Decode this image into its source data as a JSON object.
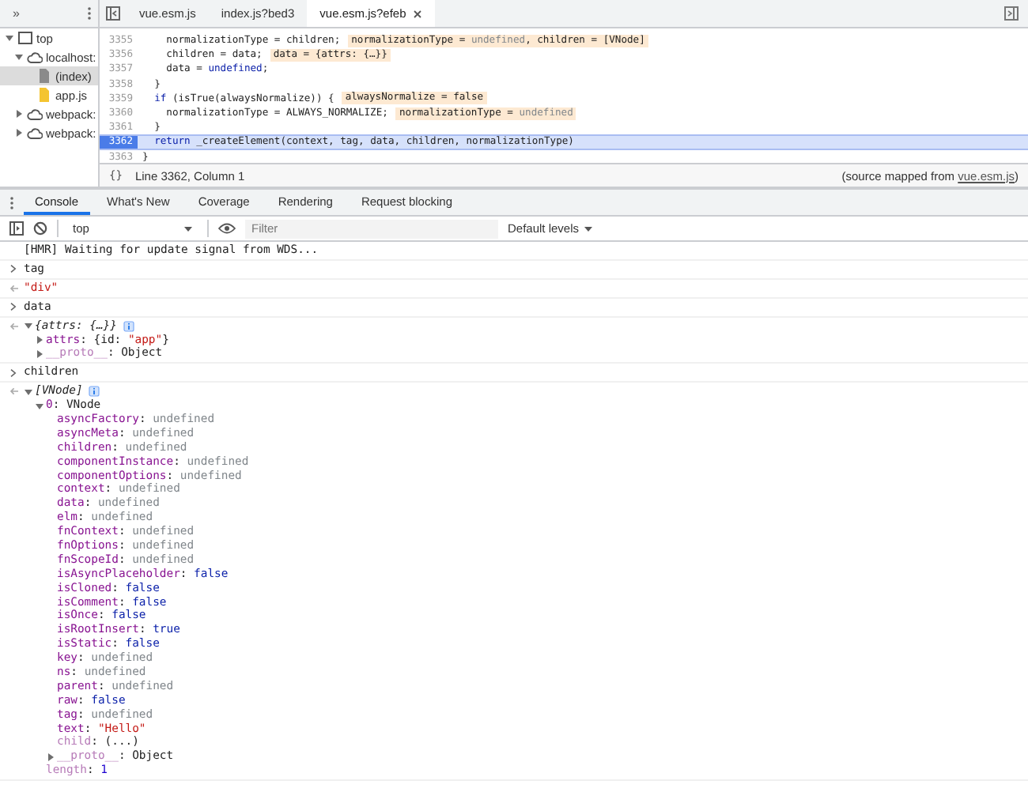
{
  "sources": {
    "navigator": {
      "overflow": "»",
      "items": [
        {
          "label": "top",
          "kind": "frame",
          "expanded": true,
          "selected": false,
          "children": [
            {
              "label": "localhost:",
              "kind": "domain",
              "expanded": true,
              "selected": false,
              "children": [
                {
                  "label": "(index)",
                  "kind": "document",
                  "selected": true
                },
                {
                  "label": "app.js",
                  "kind": "script",
                  "selected": false
                }
              ]
            },
            {
              "label": "webpack:",
              "kind": "domain",
              "expanded": false,
              "selected": false
            },
            {
              "label": "webpack:",
              "kind": "domain",
              "expanded": false,
              "selected": false
            }
          ]
        }
      ]
    },
    "tabs": [
      {
        "label": "vue.esm.js",
        "selected": false
      },
      {
        "label": "index.js?bed3",
        "selected": false
      },
      {
        "label": "vue.esm.js?efeb",
        "selected": true
      }
    ],
    "code": [
      {
        "number": "3355",
        "current": false,
        "tokens": [
          {
            "text": "    normalizationType = children;",
            "kind": "plain"
          }
        ],
        "inline": [
          {
            "text": "normalizationType = ",
            "kind": "plain"
          },
          {
            "text": "undefined",
            "kind": "dim"
          },
          {
            "text": ", children = [VNode]",
            "kind": "plain"
          }
        ]
      },
      {
        "number": "3356",
        "current": false,
        "tokens": [
          {
            "text": "    children = data;",
            "kind": "plain"
          }
        ],
        "inline": [
          {
            "text": "data = {attrs: {…}}",
            "kind": "plain"
          }
        ]
      },
      {
        "number": "3357",
        "current": false,
        "tokens": [
          {
            "text": "    data = ",
            "kind": "plain"
          },
          {
            "text": "undefined",
            "kind": "kw"
          },
          {
            "text": ";",
            "kind": "plain"
          }
        ]
      },
      {
        "number": "3358",
        "current": false,
        "tokens": [
          {
            "text": "  }",
            "kind": "plain"
          }
        ]
      },
      {
        "number": "3359",
        "current": false,
        "tokens": [
          {
            "text": "  if",
            "kind": "kw"
          },
          {
            "text": " (isTrue(alwaysNormalize)) {",
            "kind": "plain"
          }
        ],
        "inline": [
          {
            "text": "alwaysNormalize = false",
            "kind": "plain"
          }
        ]
      },
      {
        "number": "3360",
        "current": false,
        "tokens": [
          {
            "text": "    normalizationType = ALWAYS_NORMALIZE;",
            "kind": "plain"
          }
        ],
        "inline": [
          {
            "text": "normalizationType = ",
            "kind": "plain"
          },
          {
            "text": "undefined",
            "kind": "dim"
          }
        ]
      },
      {
        "number": "3361",
        "current": false,
        "tokens": [
          {
            "text": "  }",
            "kind": "plain"
          }
        ]
      },
      {
        "number": "3362",
        "current": true,
        "tokens": [
          {
            "text": "  return",
            "kind": "kw"
          },
          {
            "text": " _createElement(context, tag, data, children, normalizationType)",
            "kind": "plain"
          }
        ]
      },
      {
        "number": "3363",
        "current": false,
        "tokens": [
          {
            "text": "}",
            "kind": "plain"
          }
        ]
      }
    ],
    "status": {
      "pretty_print": "{}",
      "position": "Line 3362, Column 1",
      "source_note": {
        "before": "(source mapped from ",
        "link": "vue.esm.js",
        "after": ")"
      }
    }
  },
  "console": {
    "tabs": [
      {
        "label": "Console",
        "selected": true
      },
      {
        "label": "What's New",
        "selected": false
      },
      {
        "label": "Coverage",
        "selected": false
      },
      {
        "label": "Rendering",
        "selected": false
      },
      {
        "label": "Request blocking",
        "selected": false
      }
    ],
    "toolbar": {
      "context": "top",
      "filter_placeholder": "Filter",
      "levels": "Default levels"
    },
    "messages": [
      {
        "kind": "log",
        "tokens": [
          {
            "text": "[HMR] Waiting for update signal from WDS...",
            "kind": "plain"
          }
        ]
      },
      {
        "kind": "input",
        "tokens": [
          {
            "text": "tag",
            "kind": "plain"
          }
        ]
      },
      {
        "kind": "output",
        "tokens": [
          {
            "text": "\"div\"",
            "kind": "str"
          }
        ]
      },
      {
        "kind": "input",
        "tokens": [
          {
            "text": "data",
            "kind": "plain"
          }
        ]
      },
      {
        "kind": "output",
        "tree": {
          "tokens": [
            {
              "text": "{attrs: {…}}",
              "kind": "italic"
            }
          ],
          "info": true,
          "expanded": true,
          "children": [
            {
              "tokens": [
                {
                  "text": "attrs",
                  "kind": "key"
                },
                {
                  "text": ": {id: ",
                  "kind": "plain"
                },
                {
                  "text": "\"app\"",
                  "kind": "str"
                },
                {
                  "text": "}",
                  "kind": "plain"
                }
              ],
              "expanded": false
            },
            {
              "tokens": [
                {
                  "text": "__proto__",
                  "kind": "dimkey"
                },
                {
                  "text": ": Object",
                  "kind": "plain"
                }
              ],
              "expanded": false
            }
          ]
        }
      },
      {
        "kind": "input",
        "tokens": [
          {
            "text": "children",
            "kind": "plain"
          }
        ]
      },
      {
        "kind": "output",
        "tree": {
          "tokens": [
            {
              "text": "[VNode]",
              "kind": "italic"
            }
          ],
          "info": true,
          "expanded": true,
          "children": [
            {
              "tokens": [
                {
                  "text": "0",
                  "kind": "key"
                },
                {
                  "text": ": VNode",
                  "kind": "plain"
                }
              ],
              "expanded": true,
              "children": [
                {
                  "tokens": [
                    {
                      "text": "asyncFactory",
                      "kind": "key"
                    },
                    {
                      "text": ": ",
                      "kind": "plain"
                    },
                    {
                      "text": "undefined",
                      "kind": "dim"
                    }
                  ]
                },
                {
                  "tokens": [
                    {
                      "text": "asyncMeta",
                      "kind": "key"
                    },
                    {
                      "text": ": ",
                      "kind": "plain"
                    },
                    {
                      "text": "undefined",
                      "kind": "dim"
                    }
                  ]
                },
                {
                  "tokens": [
                    {
                      "text": "children",
                      "kind": "key"
                    },
                    {
                      "text": ": ",
                      "kind": "plain"
                    },
                    {
                      "text": "undefined",
                      "kind": "dim"
                    }
                  ]
                },
                {
                  "tokens": [
                    {
                      "text": "componentInstance",
                      "kind": "key"
                    },
                    {
                      "text": ": ",
                      "kind": "plain"
                    },
                    {
                      "text": "undefined",
                      "kind": "dim"
                    }
                  ]
                },
                {
                  "tokens": [
                    {
                      "text": "componentOptions",
                      "kind": "key"
                    },
                    {
                      "text": ": ",
                      "kind": "plain"
                    },
                    {
                      "text": "undefined",
                      "kind": "dim"
                    }
                  ]
                },
                {
                  "tokens": [
                    {
                      "text": "context",
                      "kind": "key"
                    },
                    {
                      "text": ": ",
                      "kind": "plain"
                    },
                    {
                      "text": "undefined",
                      "kind": "dim"
                    }
                  ]
                },
                {
                  "tokens": [
                    {
                      "text": "data",
                      "kind": "key"
                    },
                    {
                      "text": ": ",
                      "kind": "plain"
                    },
                    {
                      "text": "undefined",
                      "kind": "dim"
                    }
                  ]
                },
                {
                  "tokens": [
                    {
                      "text": "elm",
                      "kind": "key"
                    },
                    {
                      "text": ": ",
                      "kind": "plain"
                    },
                    {
                      "text": "undefined",
                      "kind": "dim"
                    }
                  ]
                },
                {
                  "tokens": [
                    {
                      "text": "fnContext",
                      "kind": "key"
                    },
                    {
                      "text": ": ",
                      "kind": "plain"
                    },
                    {
                      "text": "undefined",
                      "kind": "dim"
                    }
                  ]
                },
                {
                  "tokens": [
                    {
                      "text": "fnOptions",
                      "kind": "key"
                    },
                    {
                      "text": ": ",
                      "kind": "plain"
                    },
                    {
                      "text": "undefined",
                      "kind": "dim"
                    }
                  ]
                },
                {
                  "tokens": [
                    {
                      "text": "fnScopeId",
                      "kind": "key"
                    },
                    {
                      "text": ": ",
                      "kind": "plain"
                    },
                    {
                      "text": "undefined",
                      "kind": "dim"
                    }
                  ]
                },
                {
                  "tokens": [
                    {
                      "text": "isAsyncPlaceholder",
                      "kind": "key"
                    },
                    {
                      "text": ": ",
                      "kind": "plain"
                    },
                    {
                      "text": "false",
                      "kind": "kw"
                    }
                  ]
                },
                {
                  "tokens": [
                    {
                      "text": "isCloned",
                      "kind": "key"
                    },
                    {
                      "text": ": ",
                      "kind": "plain"
                    },
                    {
                      "text": "false",
                      "kind": "kw"
                    }
                  ]
                },
                {
                  "tokens": [
                    {
                      "text": "isComment",
                      "kind": "key"
                    },
                    {
                      "text": ": ",
                      "kind": "plain"
                    },
                    {
                      "text": "false",
                      "kind": "kw"
                    }
                  ]
                },
                {
                  "tokens": [
                    {
                      "text": "isOnce",
                      "kind": "key"
                    },
                    {
                      "text": ": ",
                      "kind": "plain"
                    },
                    {
                      "text": "false",
                      "kind": "kw"
                    }
                  ]
                },
                {
                  "tokens": [
                    {
                      "text": "isRootInsert",
                      "kind": "key"
                    },
                    {
                      "text": ": ",
                      "kind": "plain"
                    },
                    {
                      "text": "true",
                      "kind": "kw"
                    }
                  ]
                },
                {
                  "tokens": [
                    {
                      "text": "isStatic",
                      "kind": "key"
                    },
                    {
                      "text": ": ",
                      "kind": "plain"
                    },
                    {
                      "text": "false",
                      "kind": "kw"
                    }
                  ]
                },
                {
                  "tokens": [
                    {
                      "text": "key",
                      "kind": "key"
                    },
                    {
                      "text": ": ",
                      "kind": "plain"
                    },
                    {
                      "text": "undefined",
                      "kind": "dim"
                    }
                  ]
                },
                {
                  "tokens": [
                    {
                      "text": "ns",
                      "kind": "key"
                    },
                    {
                      "text": ": ",
                      "kind": "plain"
                    },
                    {
                      "text": "undefined",
                      "kind": "dim"
                    }
                  ]
                },
                {
                  "tokens": [
                    {
                      "text": "parent",
                      "kind": "key"
                    },
                    {
                      "text": ": ",
                      "kind": "plain"
                    },
                    {
                      "text": "undefined",
                      "kind": "dim"
                    }
                  ]
                },
                {
                  "tokens": [
                    {
                      "text": "raw",
                      "kind": "key"
                    },
                    {
                      "text": ": ",
                      "kind": "plain"
                    },
                    {
                      "text": "false",
                      "kind": "kw"
                    }
                  ]
                },
                {
                  "tokens": [
                    {
                      "text": "tag",
                      "kind": "key"
                    },
                    {
                      "text": ": ",
                      "kind": "plain"
                    },
                    {
                      "text": "undefined",
                      "kind": "dim"
                    }
                  ]
                },
                {
                  "tokens": [
                    {
                      "text": "text",
                      "kind": "key"
                    },
                    {
                      "text": ": ",
                      "kind": "plain"
                    },
                    {
                      "text": "\"Hello\"",
                      "kind": "str"
                    }
                  ]
                },
                {
                  "tokens": [
                    {
                      "text": "child",
                      "kind": "dimkey"
                    },
                    {
                      "text": ": (...)",
                      "kind": "plain"
                    }
                  ]
                },
                {
                  "tokens": [
                    {
                      "text": "__proto__",
                      "kind": "dimkey"
                    },
                    {
                      "text": ": Object",
                      "kind": "plain"
                    }
                  ],
                  "expanded": false
                }
              ]
            },
            {
              "tokens": [
                {
                  "text": "length",
                  "kind": "dimkey"
                },
                {
                  "text": ": ",
                  "kind": "plain"
                },
                {
                  "text": "1",
                  "kind": "num"
                }
              ]
            }
          ]
        }
      }
    ]
  }
}
